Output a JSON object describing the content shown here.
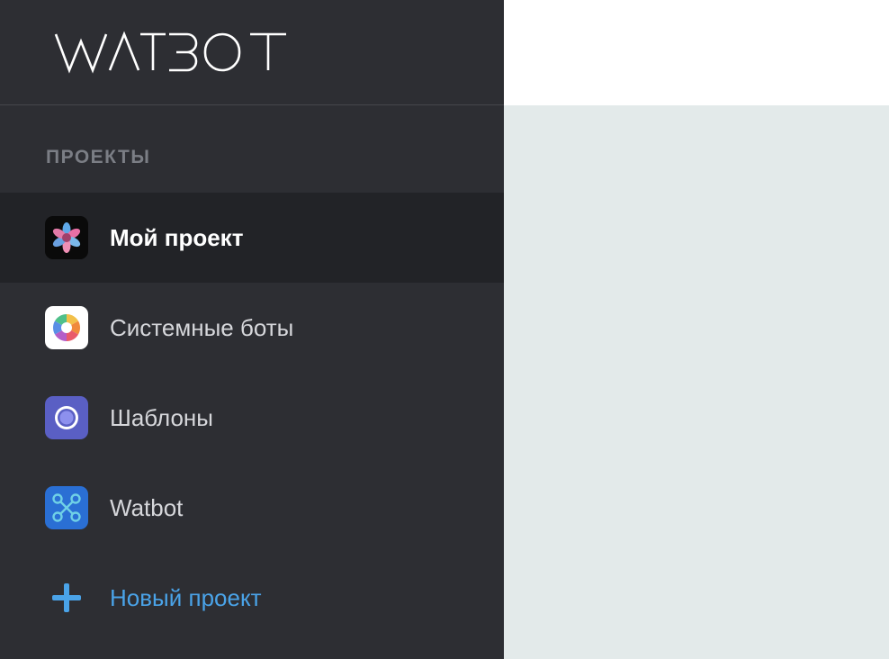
{
  "brand": {
    "logo_text": "WATBOT"
  },
  "sidebar": {
    "section_title": "ПРОЕКТЫ",
    "items": [
      {
        "label": "Мой проект",
        "icon": "flower-icon",
        "active": true
      },
      {
        "label": "Системные боты",
        "icon": "color-wheel-icon",
        "active": false
      },
      {
        "label": "Шаблоны",
        "icon": "circle-target-icon",
        "active": false
      },
      {
        "label": "Watbot",
        "icon": "network-nodes-icon",
        "active": false
      }
    ],
    "new_project_label": "Новый проект"
  },
  "colors": {
    "sidebar_bg": "#2d2e33",
    "active_item_bg": "#222327",
    "accent": "#4aa3e8",
    "content_bg": "#e3eaea"
  }
}
